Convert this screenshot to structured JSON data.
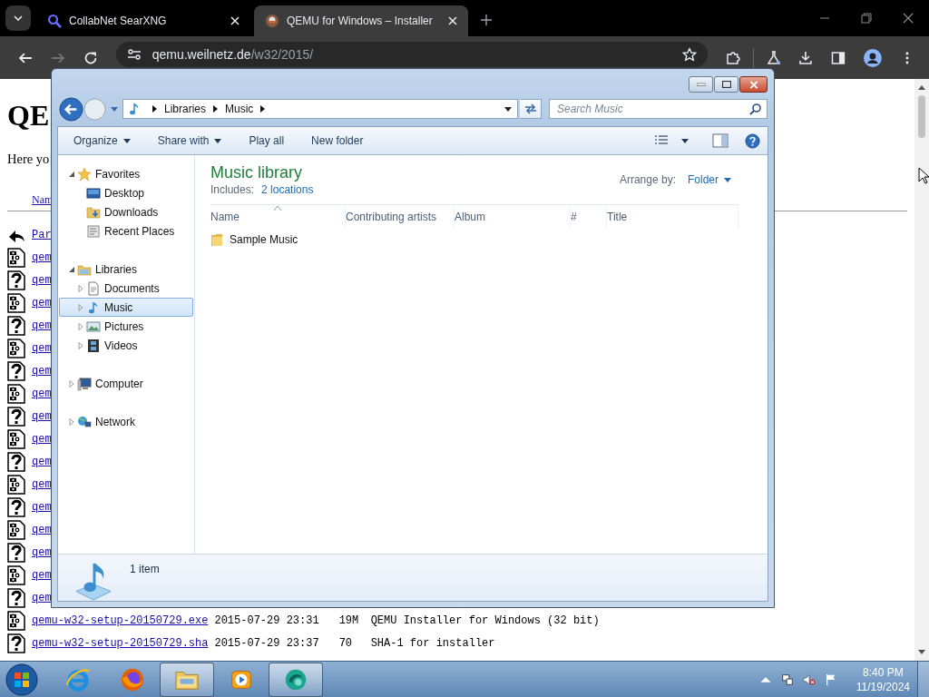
{
  "browser": {
    "tabs": [
      {
        "title": "CollabNet SearXNG",
        "selected": false,
        "kind": "search"
      },
      {
        "title": "QEMU for Windows – Installer",
        "selected": true,
        "kind": "site"
      }
    ],
    "forward_disabled": true,
    "address": {
      "host": "qemu.weilnetz.de",
      "path": "/w32/2015/"
    }
  },
  "page": {
    "heading": "QE",
    "intro": "Here yo",
    "header_link": "Nam",
    "rows": [
      {
        "kind": "back",
        "name": "Par"
      },
      {
        "kind": "binary",
        "name": "qem"
      },
      {
        "kind": "unknown",
        "name": "qem"
      },
      {
        "kind": "binary",
        "name": "qem"
      },
      {
        "kind": "unknown",
        "name": "qem"
      },
      {
        "kind": "binary",
        "name": "qem"
      },
      {
        "kind": "unknown",
        "name": "qem"
      },
      {
        "kind": "binary",
        "name": "qem"
      },
      {
        "kind": "unknown",
        "name": "qem"
      },
      {
        "kind": "binary",
        "name": "qem"
      },
      {
        "kind": "unknown",
        "name": "qem"
      },
      {
        "kind": "binary",
        "name": "qem"
      },
      {
        "kind": "unknown",
        "name": "qem"
      },
      {
        "kind": "binary",
        "name": "qem"
      },
      {
        "kind": "unknown",
        "name": "qem"
      },
      {
        "kind": "binary",
        "name": "qem"
      },
      {
        "kind": "unknown",
        "name": "qem"
      },
      {
        "kind": "binary",
        "name": "qemu-w32-setup-20150729.exe",
        "date": "2015-07-29 23:31",
        "size": "19M",
        "description": "QEMU Installer for Windows (32 bit)"
      },
      {
        "kind": "unknown",
        "name": "qemu-w32-setup-20150729.sha",
        "date": "2015-07-29 23:37",
        "size": "70",
        "description": "SHA-1 for installer"
      }
    ]
  },
  "explorer": {
    "breadcrumb": [
      "Libraries",
      "Music"
    ],
    "search": {
      "placeholder": "Search Music"
    },
    "commands": [
      {
        "label": "Organize",
        "menu": true
      },
      {
        "label": "Share with",
        "menu": true
      },
      {
        "label": "Play all",
        "menu": false
      },
      {
        "label": "New folder",
        "menu": false
      }
    ],
    "navigation": [
      {
        "label": "Favorites",
        "kind": "star",
        "expandable": true,
        "expanded": true,
        "selected": false,
        "children": [
          {
            "label": "Desktop",
            "kind": "desktop",
            "expandable": false,
            "expanded": false,
            "selected": false
          },
          {
            "label": "Downloads",
            "kind": "downloads",
            "expandable": false,
            "expanded": false,
            "selected": false
          },
          {
            "label": "Recent Places",
            "kind": "recent",
            "expandable": false,
            "expanded": false,
            "selected": false
          }
        ]
      },
      {
        "label": "Libraries",
        "kind": "library",
        "expandable": true,
        "expanded": true,
        "selected": false,
        "children": [
          {
            "label": "Documents",
            "kind": "documents",
            "expandable": true,
            "expanded": false,
            "selected": false
          },
          {
            "label": "Music",
            "kind": "music",
            "expandable": true,
            "expanded": false,
            "selected": true
          },
          {
            "label": "Pictures",
            "kind": "pictures",
            "expandable": true,
            "expanded": false,
            "selected": false
          },
          {
            "label": "Videos",
            "kind": "videos",
            "expandable": true,
            "expanded": false,
            "selected": false
          }
        ]
      },
      {
        "label": "Computer",
        "kind": "computer",
        "expandable": true,
        "expanded": false,
        "selected": false
      },
      {
        "label": "Network",
        "kind": "network",
        "expandable": true,
        "expanded": false,
        "selected": false
      }
    ],
    "library": {
      "title": "Music library",
      "includes_label": "Includes:",
      "includes_link": "2 locations",
      "arrange_label": "Arrange by:",
      "arrange_value": "Folder"
    },
    "columns": [
      {
        "label": "Name",
        "sorted": true
      },
      {
        "label": "Contributing artists",
        "sorted": false
      },
      {
        "label": "Album",
        "sorted": false
      },
      {
        "label": "#",
        "sorted": false
      },
      {
        "label": "Title",
        "sorted": false
      }
    ],
    "items": [
      {
        "name": "Sample Music",
        "kind": "folder"
      }
    ],
    "status": "1 item"
  },
  "taskbar": {
    "apps": [
      {
        "kind": "ie",
        "active": false
      },
      {
        "kind": "firefox",
        "active": false
      },
      {
        "kind": "explorer",
        "active": true
      },
      {
        "kind": "media",
        "active": false
      },
      {
        "kind": "app",
        "active": true
      }
    ],
    "muted": true,
    "time": "8:40 PM",
    "date": "11/19/2024"
  }
}
